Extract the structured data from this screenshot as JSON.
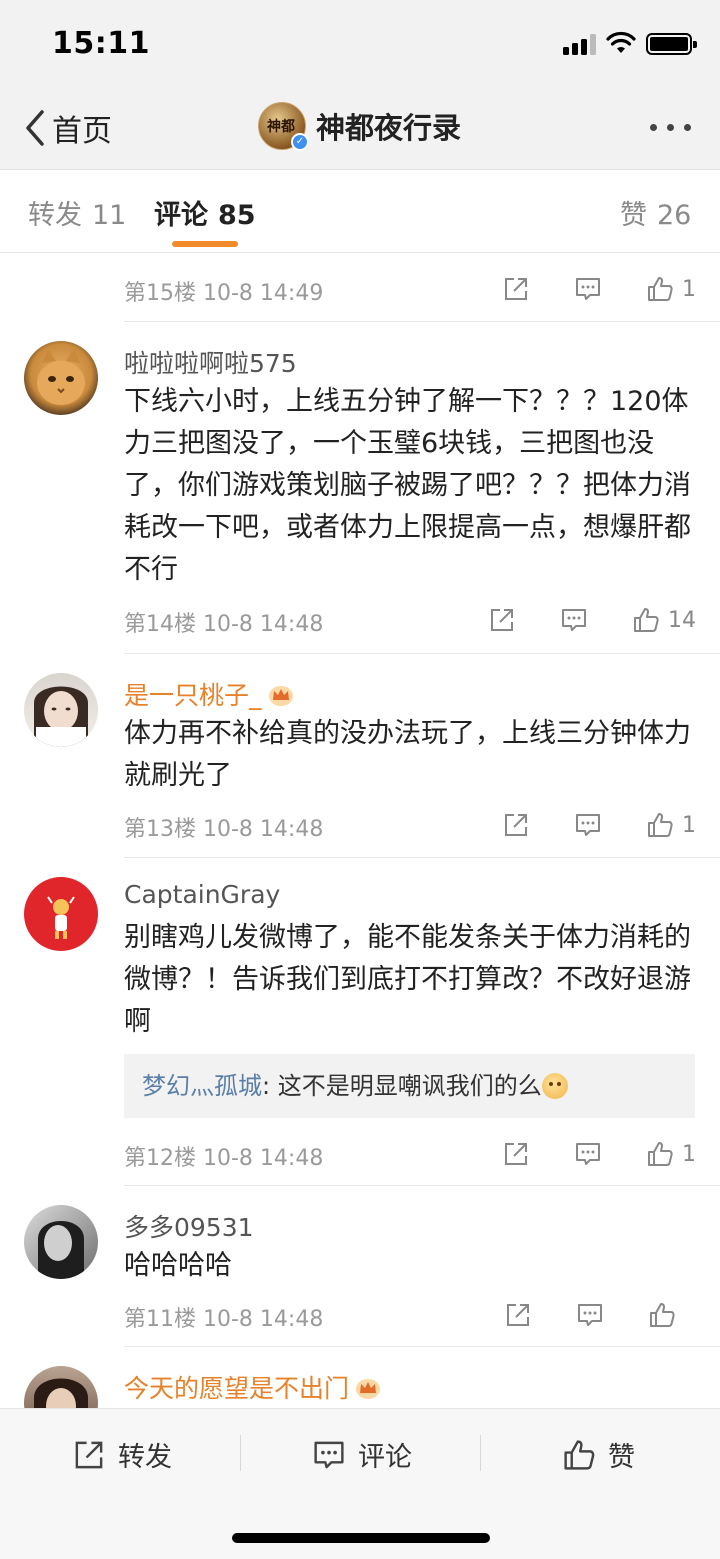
{
  "status": {
    "time": "15:11"
  },
  "nav": {
    "back_label": "首页",
    "title": "神都夜行录",
    "avatar_glyph": "神都"
  },
  "tabs": [
    {
      "label": "转发",
      "count": "11"
    },
    {
      "label": "评论",
      "count": "85"
    },
    {
      "label": "赞",
      "count": "26"
    }
  ],
  "comments": [
    {
      "floor": "第15楼",
      "date": "10-8 14:49",
      "likes": "1"
    },
    {
      "username": "啦啦啦啊啦575",
      "text": "下线六小时，上线五分钟了解一下？？？120体力三把图没了，一个玉璧6块钱，三把图也没了，你们游戏策划脑子被踢了吧？？？把体力消耗改一下吧，或者体力上限提高一点，想爆肝都不行",
      "floor": "第14楼",
      "date": "10-8 14:48",
      "likes": "14"
    },
    {
      "username": "是一只桃子_",
      "text": "体力再不补给真的没办法玩了，上线三分钟体力就刷光了",
      "floor": "第13楼",
      "date": "10-8 14:48",
      "likes": "1"
    },
    {
      "username": "CaptainGray",
      "text": "别瞎鸡儿发微博了，能不能发条关于体力消耗的微博？！告诉我们到底打不打算改？不改好退游啊",
      "reply_user": "梦幻灬孤城",
      "reply_text": "这不是明显嘲讽我们的么",
      "floor": "第12楼",
      "date": "10-8 14:48",
      "likes": "1"
    },
    {
      "username": "多多09531",
      "text": "哈哈哈哈",
      "floor": "第11楼",
      "date": "10-8 14:48",
      "likes": ""
    },
    {
      "username": "今天的愿望是不出门"
    }
  ],
  "bottom": {
    "repost": "转发",
    "comment": "评论",
    "like": "赞"
  },
  "colors": {
    "accent": "#f08a2b",
    "vip_name": "#e5822b",
    "reply_user": "#5b7fa6"
  }
}
